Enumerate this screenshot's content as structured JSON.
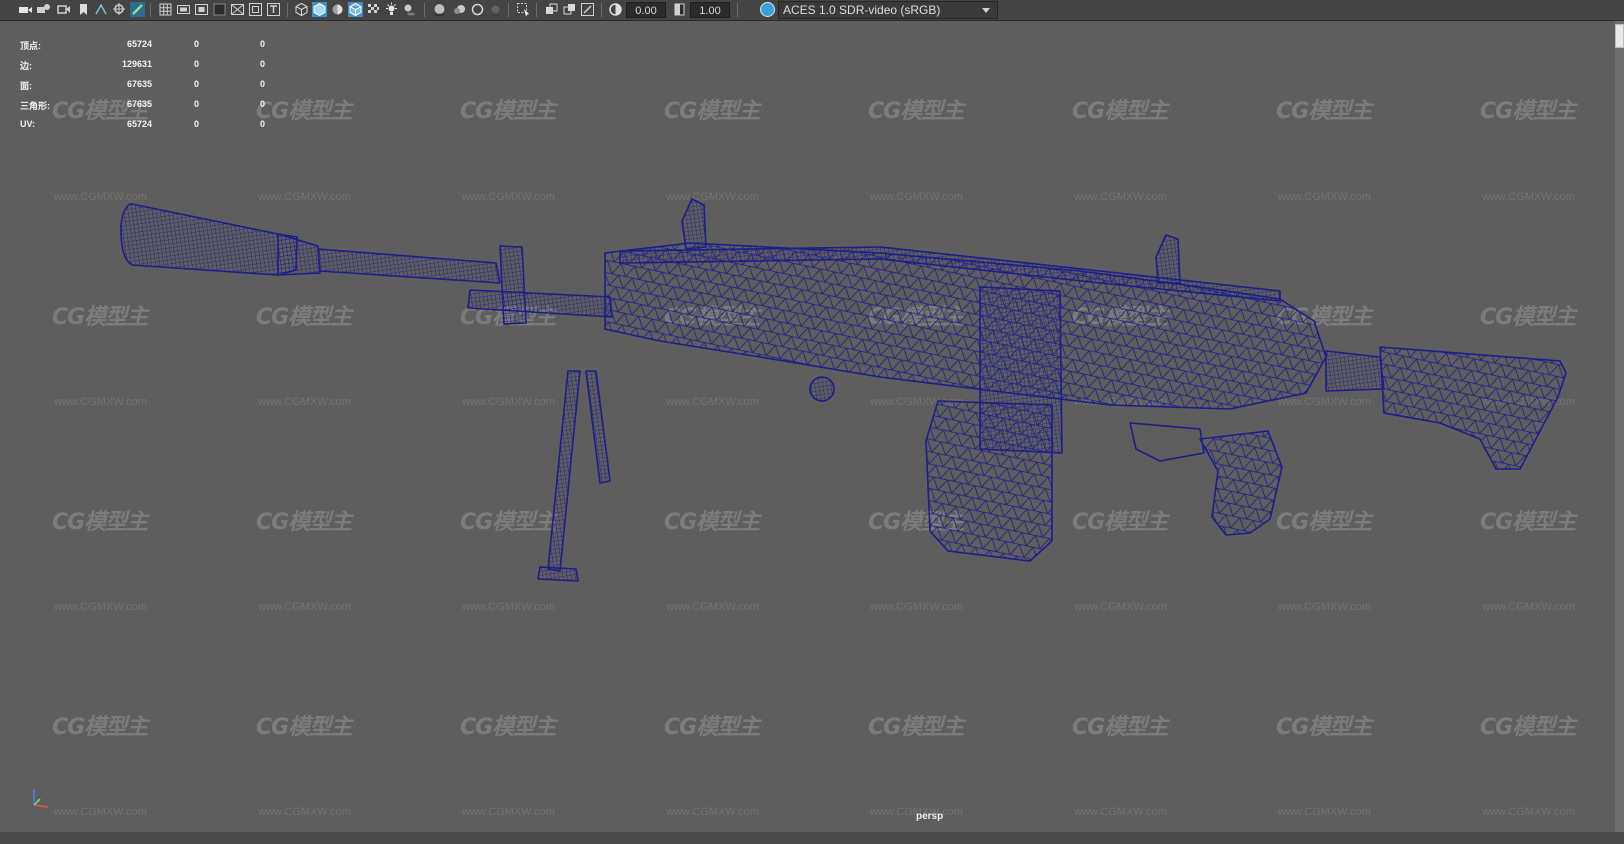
{
  "toolbar": {
    "exposure_value": "0.00",
    "gamma_value": "1.00",
    "color_space": "ACES 1.0 SDR-video (sRGB)",
    "icons": [
      "camera-icon",
      "camera-attributes-icon",
      "bookmark-icon",
      "image-plane-icon",
      "grid-icon",
      "film-gate-icon",
      "resolution-gate-icon",
      "safe-action-icon",
      "wireframe-icon",
      "smooth-shade-icon",
      "textured-icon",
      "lights-icon",
      "shadows-icon",
      "isolate-select-icon",
      "exposure-icon",
      "gamma-icon",
      "color-management-icon"
    ]
  },
  "hud": {
    "rows": [
      {
        "label": "顶点:",
        "v1": "65724",
        "v2": "0",
        "v3": "0"
      },
      {
        "label": "边:",
        "v1": "129631",
        "v2": "0",
        "v3": "0"
      },
      {
        "label": "面:",
        "v1": "67635",
        "v2": "0",
        "v3": "0"
      },
      {
        "label": "三角形:",
        "v1": "67635",
        "v2": "0",
        "v3": "0"
      },
      {
        "label": "UV:",
        "v1": "65724",
        "v2": "0",
        "v3": "0"
      }
    ]
  },
  "watermark": {
    "logo": "CG模型主",
    "url": "www.CGMXW.com"
  },
  "viewport": {
    "camera": "persp"
  },
  "colors": {
    "background": "#5e5e5e",
    "wireframe": "#1c1e8a",
    "toolbar": "#444444"
  }
}
